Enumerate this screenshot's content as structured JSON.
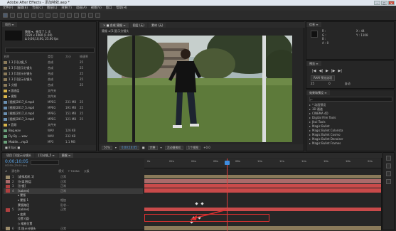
{
  "window": {
    "title": "Adobe After Effects - 添加特效.aep *"
  },
  "menu": [
    "文件(F)",
    "编辑(E)",
    "合成(C)",
    "图层(L)",
    "效果(T)",
    "动画(A)",
    "视图(V)",
    "窗口",
    "帮助(H)"
  ],
  "project": {
    "tab": "项目 ≡",
    "comp_info": [
      "猿猴 ▾，使用了 1 次",
      "1920 x 1080 (1.00)",
      "Δ 0;00;10;00, 25.00 fps"
    ],
    "columns": [
      "名称",
      "类型",
      "大小",
      "帧速率"
    ],
    "items": [
      {
        "name": "1 3 [1]分镜_5",
        "type": "合成",
        "size": "",
        "fps": "25",
        "color": "#8a7a5a"
      },
      {
        "name": "1 3 [1]显示分镜头",
        "type": "合成",
        "size": "",
        "fps": "25",
        "color": "#8a7a5a"
      },
      {
        "name": "1 3 [1]显示分镜头",
        "type": "合成",
        "size": "",
        "fps": "25",
        "color": "#8a7a5a"
      },
      {
        "name": "1 3 [1]显示分镜头",
        "type": "合成",
        "size": "",
        "fps": "25",
        "color": "#8a7a5a"
      },
      {
        "name": "1 分镜",
        "type": "合成",
        "size": "",
        "fps": "25",
        "color": "#8a7a5a"
      },
      {
        "name": "▾ 固态层",
        "type": "文件夹",
        "size": "",
        "fps": "",
        "color": "#d8b44a"
      },
      {
        "name": "▾ 视频",
        "type": "文件夹",
        "size": "",
        "fps": "",
        "color": "#d8b44a"
      },
      {
        "name": "[视频]2017_6.mp4",
        "type": "MPEG",
        "size": "231 MB",
        "fps": "25",
        "color": "#6a8fb0"
      },
      {
        "name": "[视频]2017_5.mp4",
        "type": "MPEG",
        "size": "191 MB",
        "fps": "25",
        "color": "#6a8fb0"
      },
      {
        "name": "[视频]2017_4.mp4",
        "type": "MPEG",
        "size": "151 MB",
        "fps": "25",
        "color": "#6a8fb0"
      },
      {
        "name": "[视频]2017_3.mp4",
        "type": "MPEG",
        "size": "121 MB",
        "fps": "25",
        "color": "#6a8fb0"
      },
      {
        "name": "▾ 音频",
        "type": "文件夹",
        "size": "",
        "fps": "",
        "color": "#d8b44a"
      },
      {
        "name": "Bog.wav",
        "type": "WAV",
        "size": "126 KB",
        "fps": "",
        "color": "#6aa07a"
      },
      {
        "name": "Fly By ....wav",
        "type": "WAV",
        "size": "232 KB",
        "fps": "",
        "color": "#6aa07a"
      },
      {
        "name": "Mobile....mp3",
        "type": "MP3",
        "size": "1.1 MB",
        "fps": "",
        "color": "#6aa07a"
      },
      {
        "name": "猿猴",
        "type": "合成",
        "size": "",
        "fps": "25",
        "color": "#8a7a5a"
      }
    ],
    "footer": "■ 8 bpc  ■"
  },
  "viewer": {
    "tabs": [
      "× ■ 合成 猿猴 ≡",
      "图层 (无)",
      "素材 (无)"
    ],
    "breadcrumb": "猿猴 ◂ [1]显示分镜头",
    "footer": [
      "50%",
      "▾",
      "0;00;10;05",
      "■",
      "完整",
      "▾",
      "活动摄像机",
      "1个视图",
      "+0.0"
    ]
  },
  "info": {
    "tab": "信息 ≡",
    "values": [
      "R :",
      "G :",
      "B :",
      "A : 0",
      "X : 44",
      "Y : 1108"
    ]
  },
  "preview": {
    "tab": "预览 ≡",
    "controls": [
      "|◀",
      "◀|",
      "▶",
      "|▶",
      "▶|"
    ],
    "shortcut": "RAM 预览选项",
    "fps": "25",
    "skip": "0",
    "res": "自动"
  },
  "effects": {
    "tab": "效果和预设 ≡",
    "search_placeholder": "ρ•",
    "items": [
      "* 动画预设",
      "3D 通道",
      "CINEMA 4D",
      "Digital Film Tools",
      "Jitai Tools",
      "Magic Bullet",
      "Magic Bullet Colorista",
      "Magic Bullet Cosmo",
      "Magic Bullet Denoiser",
      "Magic Bullet Frames"
    ]
  },
  "timeline": {
    "tabs": [
      "项目 [1]显示分镜头",
      "[1]分镜_5 ≡",
      "猿猴 ≡"
    ],
    "timecode": "0;00;10;05",
    "tc_sub": "00255 (25.00 fps)",
    "ruler": [
      "0s",
      "02s",
      "04s",
      "06s",
      "08s",
      "10s",
      "12s",
      "14s",
      "16s",
      "18s",
      "20s"
    ],
    "header": [
      "#",
      "源名称",
      "模式",
      "T TrkMat",
      "父级"
    ],
    "layers": [
      {
        "num": "1",
        "name": "[虚拟相机 1]",
        "mode": "正常",
        "color": "#9a8a6a"
      },
      {
        "num": "2",
        "name": "[分离]图层",
        "mode": "正常",
        "color": "#aa6a6a"
      },
      {
        "num": "3",
        "name": "[分镜]",
        "mode": "正常",
        "color": "#b04040"
      },
      {
        "num": "4",
        "name": "[sabres]",
        "mode": "正常",
        "color": "#b04040"
      },
      {
        "num": "",
        "name": "▾ 蒙版",
        "mode": "",
        "color": ""
      },
      {
        "num": "",
        "name": "▾ 蒙版 1",
        "mode": "相加",
        "color": ""
      },
      {
        "num": "",
        "name": "  蒙版路径",
        "mode": "形状...",
        "color": ""
      },
      {
        "num": "5",
        "name": "[sabres]",
        "mode": "正常",
        "color": "#b04040"
      },
      {
        "num": "",
        "name": "▾ 变换",
        "mode": "",
        "color": ""
      },
      {
        "num": "",
        "name": "  位置 (值)",
        "mode": "",
        "color": ""
      },
      {
        "num": "",
        "name": "  ◇ 缩放位置",
        "mode": "",
        "color": ""
      },
      {
        "num": "6",
        "name": "[1]显示分镜头",
        "mode": "正常",
        "color": "#9a8a6a"
      }
    ]
  },
  "colors": {
    "accent": "#3f8de0",
    "cti": "#e04040",
    "highlight": "#e03030",
    "layer_bar": "#c94a4a",
    "comp_bar": "#8a7a5a"
  }
}
